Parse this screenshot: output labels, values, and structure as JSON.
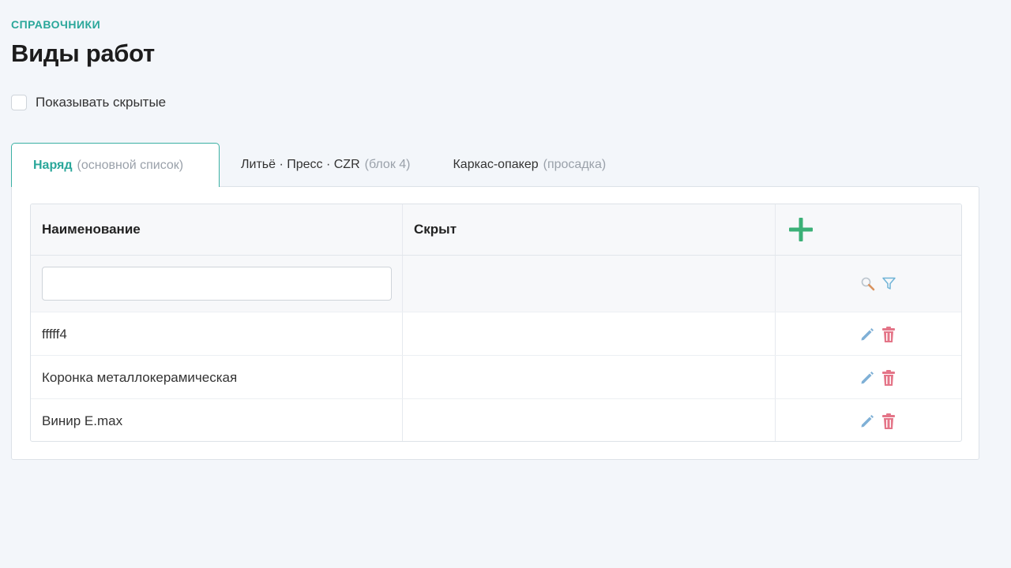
{
  "header": {
    "breadcrumb": "СПРАВОЧНИКИ",
    "title": "Виды работ"
  },
  "show_hidden": {
    "label": "Показывать скрытые",
    "checked": false
  },
  "tabs": [
    {
      "label": "Наряд",
      "note": "(основной список)",
      "active": true
    },
    {
      "label": "Литьё · Пресс · CZR",
      "note": "(блок 4)",
      "active": false
    },
    {
      "label": "Каркас-опакер",
      "note": "(просадка)",
      "active": false
    }
  ],
  "table": {
    "columns": [
      "Наименование",
      "Скрыт"
    ],
    "filter_value": "",
    "rows": [
      {
        "name": "fffff4",
        "hidden": ""
      },
      {
        "name": "Коронка металлокерамическая",
        "hidden": ""
      },
      {
        "name": "Винир E.max",
        "hidden": ""
      }
    ]
  },
  "icons": {
    "add": "plus-icon",
    "search": "search-icon",
    "filter": "filter-icon",
    "edit": "pencil-icon",
    "delete": "trash-icon"
  },
  "colors": {
    "accent": "#2aa79a",
    "add": "#3bb077",
    "edit": "#7fb0d6",
    "delete": "#e47588",
    "background": "#f3f6fa"
  }
}
